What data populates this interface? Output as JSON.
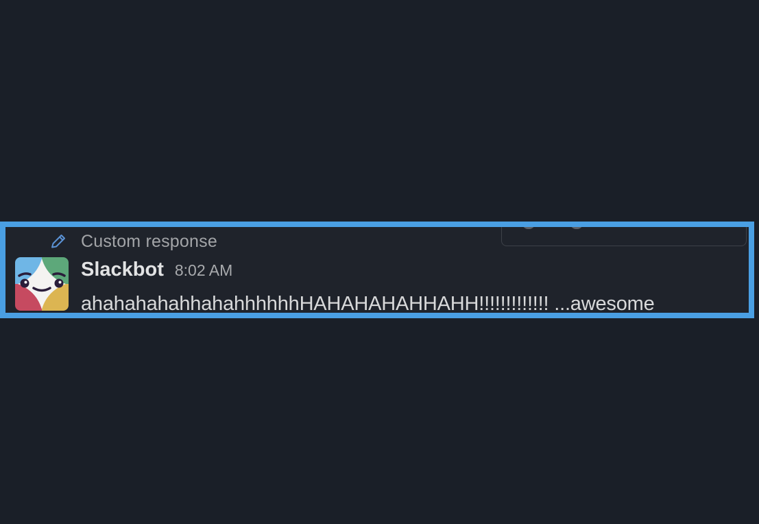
{
  "context_row": {
    "label": "Custom response",
    "icon": "pencil-icon"
  },
  "message": {
    "sender": "Slackbot",
    "timestamp": "8:02 AM",
    "text": "ahahahahahhahahhhhhhHAHAHAHAHHAHH!!!!!!!!!!!!! ...awesome",
    "avatar_icon": "slackbot-avatar-icon"
  },
  "colors": {
    "background": "#1a1f28",
    "highlight_border": "#4a9fe3",
    "message_background": "#1f232b",
    "accent_pencil": "#5b93d6"
  }
}
